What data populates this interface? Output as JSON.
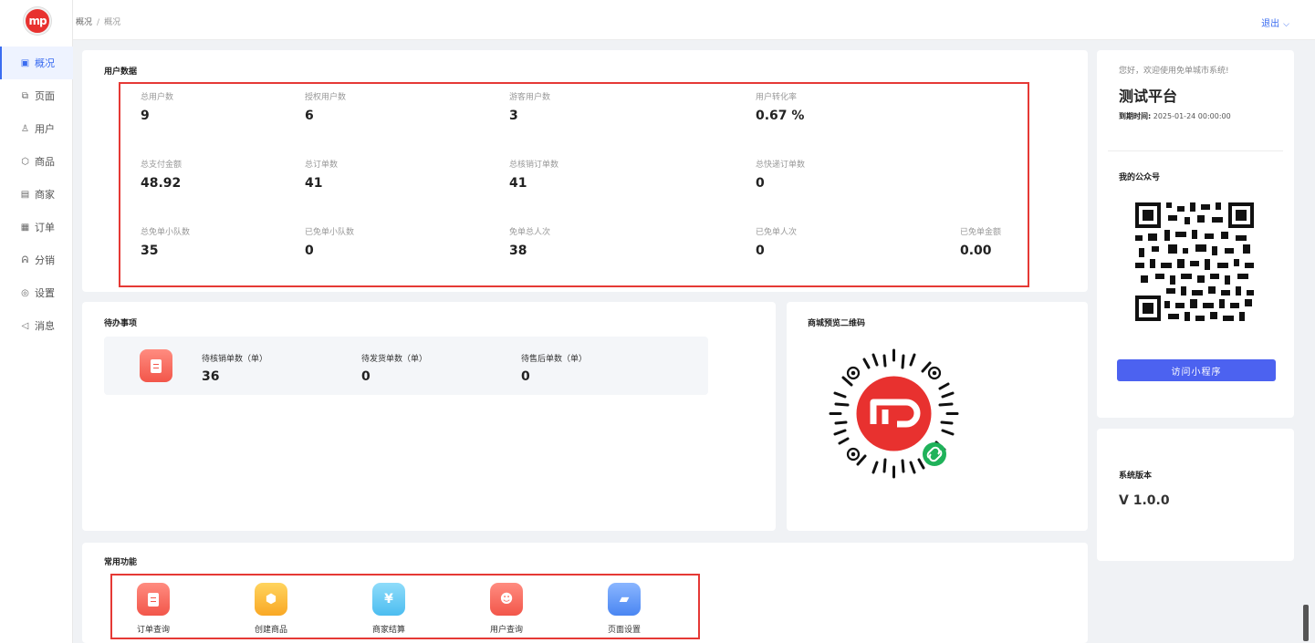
{
  "header": {
    "breadcrumb": [
      "概况",
      "概况"
    ],
    "logout_label": "退出"
  },
  "sidebar": {
    "logo_text": "mp",
    "items": [
      {
        "label": "概况",
        "icon": "chart-icon",
        "glyph": "▣",
        "active": true
      },
      {
        "label": "页面",
        "icon": "page-icon",
        "glyph": "⧉",
        "active": false
      },
      {
        "label": "用户",
        "icon": "user-icon",
        "glyph": "♙",
        "active": false
      },
      {
        "label": "商品",
        "icon": "box-icon",
        "glyph": "⬡",
        "active": false
      },
      {
        "label": "商家",
        "icon": "store-icon",
        "glyph": "▤",
        "active": false
      },
      {
        "label": "订单",
        "icon": "order-icon",
        "glyph": "▦",
        "active": false
      },
      {
        "label": "分销",
        "icon": "share-icon",
        "glyph": "ᕱ",
        "active": false
      },
      {
        "label": "设置",
        "icon": "settings-icon",
        "glyph": "◎",
        "active": false
      },
      {
        "label": "消息",
        "icon": "speaker-icon",
        "glyph": "◁",
        "active": false
      }
    ]
  },
  "user_data": {
    "title": "用户数据",
    "rows": [
      [
        {
          "label": "总用户数",
          "value": "9"
        },
        {
          "label": "授权用户数",
          "value": "6"
        },
        {
          "label": "游客用户数",
          "value": "3"
        },
        {
          "label": "用户转化率",
          "value": "0.67 %"
        }
      ],
      [
        {
          "label": "总支付金额",
          "value": "48.92"
        },
        {
          "label": "总订单数",
          "value": "41"
        },
        {
          "label": "总核销订单数",
          "value": "41"
        },
        {
          "label": "总快递订单数",
          "value": "0"
        }
      ],
      [
        {
          "label": "总免单小队数",
          "value": "35"
        },
        {
          "label": "已免单小队数",
          "value": "0"
        },
        {
          "label": "免单总人次",
          "value": "38"
        },
        {
          "label": "已免单人次",
          "value": "0"
        },
        {
          "label": "已免单金额",
          "value": "0.00"
        }
      ]
    ]
  },
  "todo": {
    "title": "待办事项",
    "items": [
      {
        "label": "待核销单数（单）",
        "value": "36"
      },
      {
        "label": "待发货单数（单）",
        "value": "0"
      },
      {
        "label": "待售后单数（单）",
        "value": "0"
      }
    ]
  },
  "mall_qr": {
    "title": "商城预览二维码"
  },
  "functions": {
    "title": "常用功能",
    "items": [
      {
        "label": "订单查询",
        "icon": "order-query-icon",
        "color": "#f2675a"
      },
      {
        "label": "创建商品",
        "icon": "create-product-icon",
        "color": "#fbbd3c"
      },
      {
        "label": "商家结算",
        "icon": "merchant-settle-icon",
        "color": "#6ccdf5"
      },
      {
        "label": "用户查询",
        "icon": "user-query-icon",
        "color": "#f2675a"
      },
      {
        "label": "页面设置",
        "icon": "page-settings-icon",
        "color": "#5f9bf7"
      }
    ]
  },
  "welcome": {
    "greeting": "您好，欢迎使用免单城市系统!",
    "platform": "测试平台",
    "expire_label": "到期时间:",
    "expire_value": "2025-01-24 00:00:00",
    "public_account": "我的公众号",
    "visit_button": "访问小程序"
  },
  "version": {
    "label": "系统版本",
    "value": "V 1.0.0"
  },
  "colors": {
    "accent": "#3a6cf0",
    "highlight_border": "#e53935",
    "brand": "#e8312f",
    "button": "#4c62f0"
  }
}
